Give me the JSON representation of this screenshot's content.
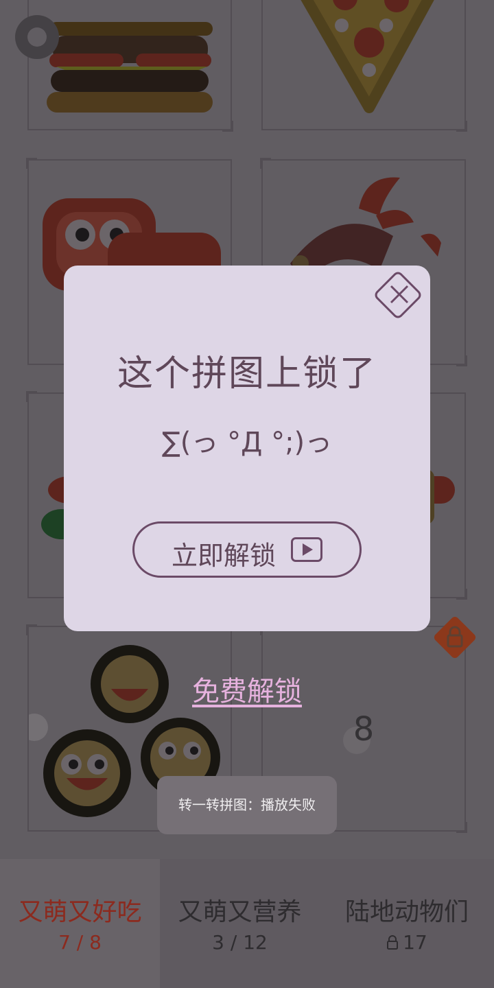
{
  "colors": {
    "background": "#6f6a70",
    "dialog_bg": "#ded6e6",
    "accent": "#6b4a67",
    "free_unlock": "#e6b2de",
    "active_tab_text": "#8c2a1e"
  },
  "dialog": {
    "title": "这个拼图上锁了",
    "kaomoji": "∑(っ °Д °;)っ",
    "unlock_button_label": "立即解锁",
    "close_icon": "close-icon",
    "video_icon": "play-video-icon"
  },
  "free_unlock_label": "免费解锁",
  "card_number": "8",
  "toast": "转一转拼图：播放失败",
  "tabs": [
    {
      "label": "又萌又好吃",
      "progress": "7 / 8",
      "active": true
    },
    {
      "label": "又萌又营养",
      "progress": "3 / 12",
      "active": false
    },
    {
      "label": "陆地动物们",
      "progress": "17",
      "active": false,
      "locked": true
    }
  ],
  "icons": {
    "settings": "gear-icon",
    "card_lock": "lock-icon",
    "tab_lock": "lock-icon"
  }
}
